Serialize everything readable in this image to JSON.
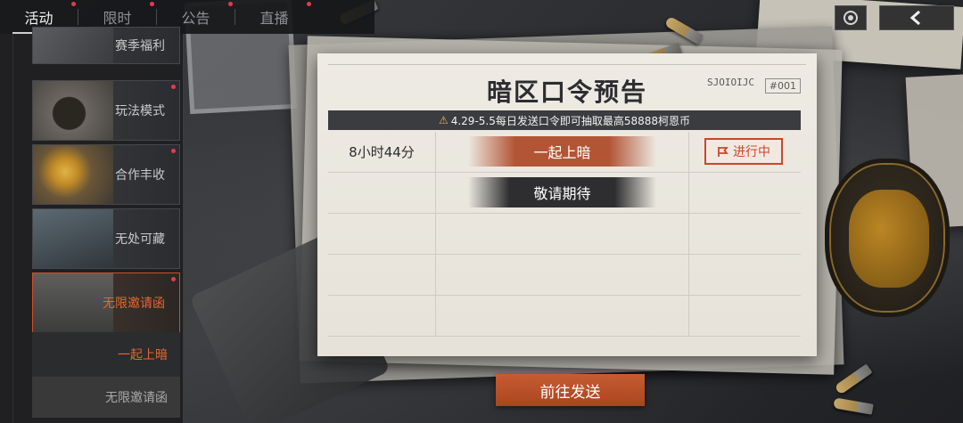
{
  "nav": {
    "tabs": [
      {
        "label": "活动",
        "active": true
      },
      {
        "label": "限时",
        "active": false
      },
      {
        "label": "公告",
        "active": false
      },
      {
        "label": "直播",
        "active": false
      }
    ]
  },
  "sidebar": {
    "items": [
      {
        "label": "赛季福利"
      },
      {
        "label": "玩法模式"
      },
      {
        "label": "合作丰收"
      },
      {
        "label": "无处可藏"
      },
      {
        "label": "无限邀请函",
        "selected": true
      }
    ],
    "subitems": [
      {
        "label": "一起上暗",
        "active": true
      },
      {
        "label": "无限邀请函",
        "active": false
      }
    ]
  },
  "card": {
    "title": "暗区口令预告",
    "code": "SJOIOIJC",
    "number": "#001",
    "banner": "4.29-5.5每日发送口令即可抽取最高58888柯恩币",
    "rows": [
      {
        "time": "8小时44分",
        "password": "一起上暗",
        "status": "进行中"
      },
      {
        "time": "",
        "password": "敬请期待",
        "status": ""
      },
      {
        "time": "",
        "password": "",
        "status": ""
      },
      {
        "time": "",
        "password": "",
        "status": ""
      },
      {
        "time": "",
        "password": "",
        "status": ""
      }
    ]
  },
  "action": {
    "label": "前往发送"
  },
  "colors": {
    "accent": "#c9472a",
    "button": "#b8502b",
    "notice_dot": "#e8394a"
  }
}
